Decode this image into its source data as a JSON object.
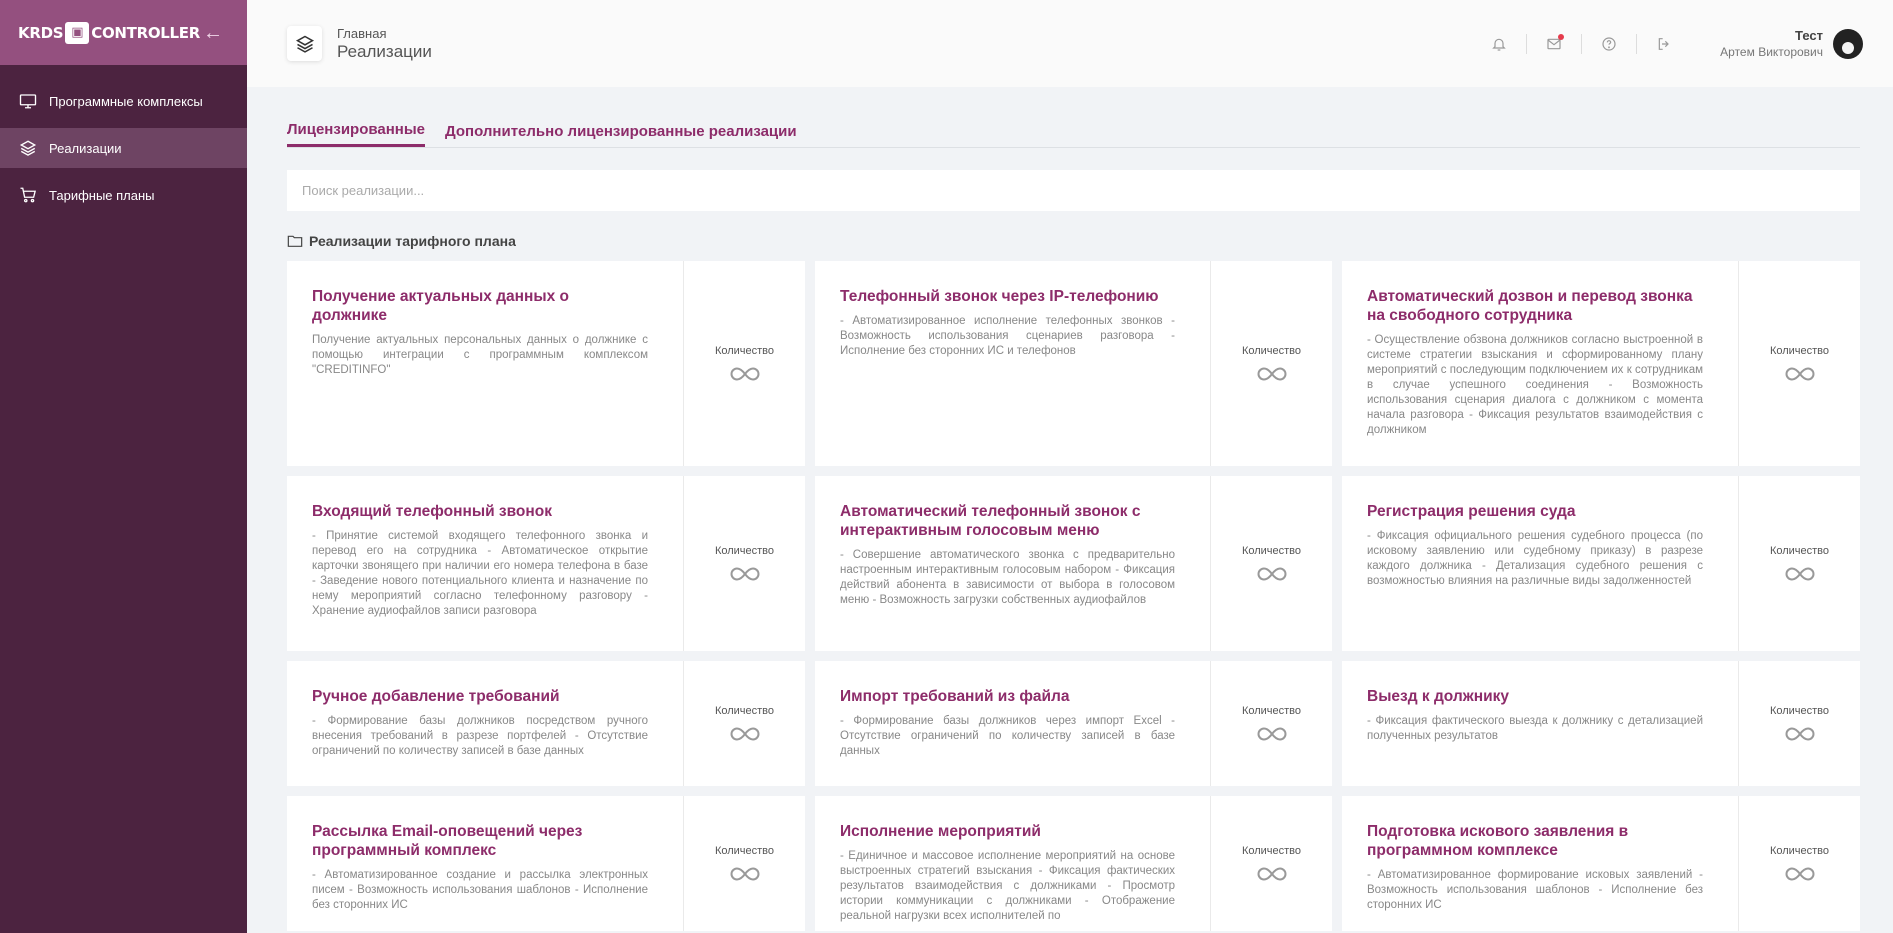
{
  "sidebar": {
    "logo_left": "KRDS",
    "logo_right": "CONTROLLER",
    "collapse_icon": "arrow-left-icon",
    "items": [
      {
        "label": "Программные комплексы",
        "icon": "monitor-icon",
        "active": false
      },
      {
        "label": "Реализации",
        "icon": "layers-icon",
        "active": true
      },
      {
        "label": "Тарифные планы",
        "icon": "cart-icon",
        "active": false
      }
    ]
  },
  "header": {
    "breadcrumb": "Главная",
    "title": "Реализации",
    "icon": "layers-icon",
    "actions": [
      "bell-icon",
      "mail-icon",
      "help-icon",
      "logout-icon"
    ],
    "user": {
      "name": "Тест",
      "subtitle": "Артем Викторович"
    }
  },
  "tabs": [
    {
      "label": "Лицензированные",
      "active": true
    },
    {
      "label": "Дополнительно лицензированные реализации",
      "active": false
    }
  ],
  "search": {
    "placeholder": "Поиск реализации...",
    "value": ""
  },
  "section": {
    "title": "Реализации тарифного плана",
    "icon": "folder-icon"
  },
  "quantity_label": "Количество",
  "quantity_icon": "infinity-icon",
  "cards": [
    {
      "title": "Получение актуальных данных о должнике",
      "description": "Получение актуальных персональных данных о должнике с помощью интеграции с программным комплексом \"CREDITINFO\""
    },
    {
      "title": "Телефонный звонок через IP-телефонию",
      "description": "- Автоматизированное исполнение телефонных звонков - Возможность использования сценариев разговора - Исполнение без сторонних ИС и телефонов"
    },
    {
      "title": "Автоматический дозвон и перевод звонка на свободного сотрудника",
      "description": "- Осуществление обзвона должников согласно выстроенной в системе стратегии взыскания и сформированному плану мероприятий с последующим подключением их к сотрудникам в случае успешного соединения - Возможность использования сценария диалога с должником с момента начала разговора - Фиксация результатов взаимодействия с должником"
    },
    {
      "title": "Входящий телефонный звонок",
      "description": "- Принятие системой входящего телефонного звонка и перевод его на сотрудника - Автоматическое открытие карточки звонящего при наличии его номера телефона в базе - Заведение нового потенциального клиента и назначение по нему мероприятий согласно телефонному разговору - Хранение аудиофайлов записи разговора"
    },
    {
      "title": "Автоматический телефонный звонок с интерактивным голосовым меню",
      "description": "- Совершение автоматического звонка с предварительно настроенным интерактивным голосовым набором - Фиксация действий абонента в зависимости от выбора в голосовом меню - Возможность загрузки собственных аудиофайлов"
    },
    {
      "title": "Регистрация решения суда",
      "description": "- Фиксация официального решения судебного процесса (по исковому заявлению или судебному приказу) в разрезе каждого должника - Детализация судебного решения с возможностью влияния на различные виды задолженностей"
    },
    {
      "title": "Ручное добавление требований",
      "description": "- Формирование базы должников посредством ручного внесения требований в разрезе портфелей - Отсутствие ограничений по количеству записей в базе данных"
    },
    {
      "title": "Импорт требований из файла",
      "description": "- Формирование базы должников через импорт Excel - Отсутствие ограничений по количеству записей в базе данных"
    },
    {
      "title": "Выезд к должнику",
      "description": "- Фиксация фактического выезда к должнику с детализацией полученных результатов"
    },
    {
      "title": "Рассылка Email-оповещений через программный комплекс",
      "description": "- Автоматизированное создание и рассылка электронных писем - Возможность использования шаблонов - Исполнение без сторонних ИС"
    },
    {
      "title": "Исполнение мероприятий",
      "description": "- Единичное и массовое исполнение мероприятий на основе выстроенных стратегий взыскания - Фиксация фактических результатов взаимодействия с должниками - Просмотр истории коммуникации с должниками - Отображение реальной нагрузки всех исполнителей по"
    },
    {
      "title": "Подготовка искового заявления в программном комплексе",
      "description": "- Автоматизированное формирование исковых заявлений - Возможность использования шаблонов - Исполнение без сторонних ИС"
    }
  ]
}
